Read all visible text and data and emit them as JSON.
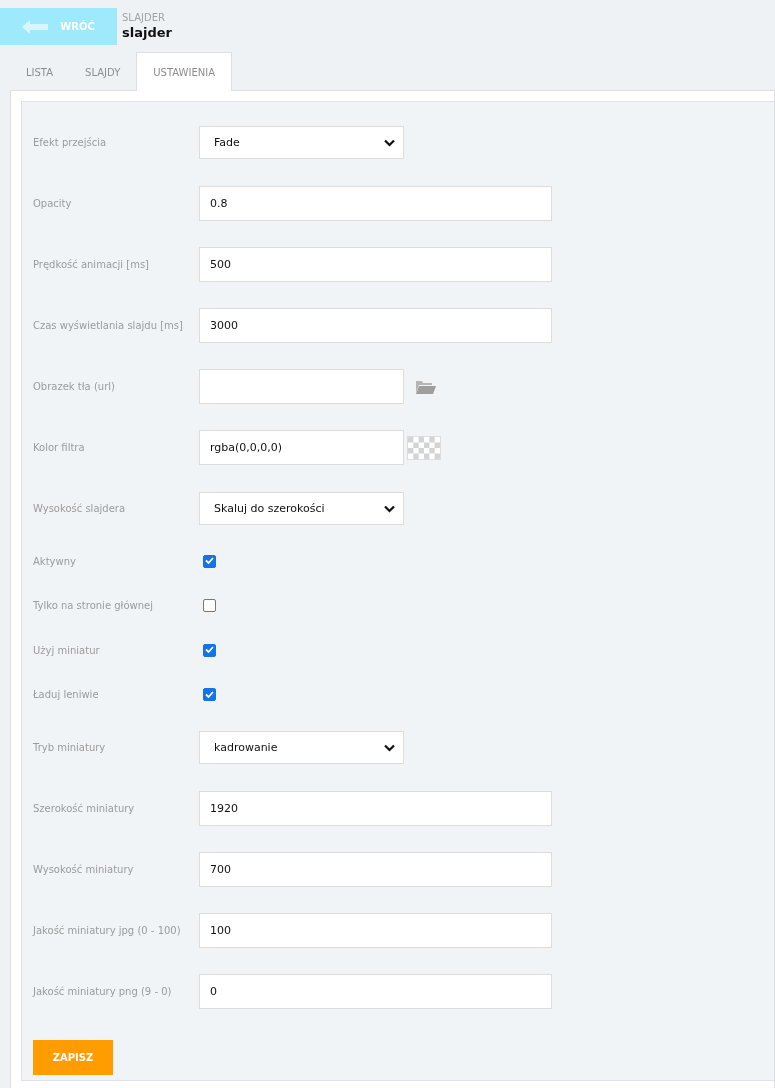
{
  "header": {
    "back_button": "WRÓĆ",
    "section": "SLAJDER",
    "title": "slajder"
  },
  "tabs": [
    {
      "label": "LISTA",
      "selected": false
    },
    {
      "label": "SLAJDY",
      "selected": false
    },
    {
      "label": "USTAWIENIA",
      "selected": true
    }
  ],
  "fields": [
    {
      "kind": "select",
      "label": "Efekt przejścia",
      "value": "Fade"
    },
    {
      "kind": "text",
      "label": "Opacity",
      "value": "0.8"
    },
    {
      "kind": "text",
      "label": "Prędkość animacji [ms]",
      "value": "500"
    },
    {
      "kind": "text",
      "label": "Czas wyświetlania slajdu [ms]",
      "value": "3000"
    },
    {
      "kind": "file",
      "label": "Obrazek tła (url)"
    },
    {
      "kind": "color",
      "label": "Kolor filtra",
      "value": "rgba(0,0,0,0)"
    },
    {
      "kind": "select",
      "label": "Wysokość slajdera",
      "value": "Skaluj do szerokości"
    },
    {
      "kind": "checkbox",
      "label": "Aktywny",
      "checked": true
    },
    {
      "kind": "checkbox",
      "label": "Tylko na stronie głównej",
      "checked": false
    },
    {
      "kind": "checkbox",
      "label": "Użyj miniatur",
      "checked": true
    },
    {
      "kind": "checkbox",
      "label": "Ładuj leniwie",
      "checked": true
    },
    {
      "kind": "select",
      "label": "Tryb miniatury",
      "value": "kadrowanie"
    },
    {
      "kind": "text",
      "label": "Szerokość miniatury",
      "value": "1920"
    },
    {
      "kind": "text",
      "label": "Wysokość miniatury",
      "value": "700"
    },
    {
      "kind": "text",
      "label": "Jakość miniatury jpg (0 - 100)",
      "value": "100"
    },
    {
      "kind": "text",
      "label": "Jakość miniatury png (9 - 0)",
      "value": "0"
    }
  ],
  "save_button": "ZAPISZ"
}
